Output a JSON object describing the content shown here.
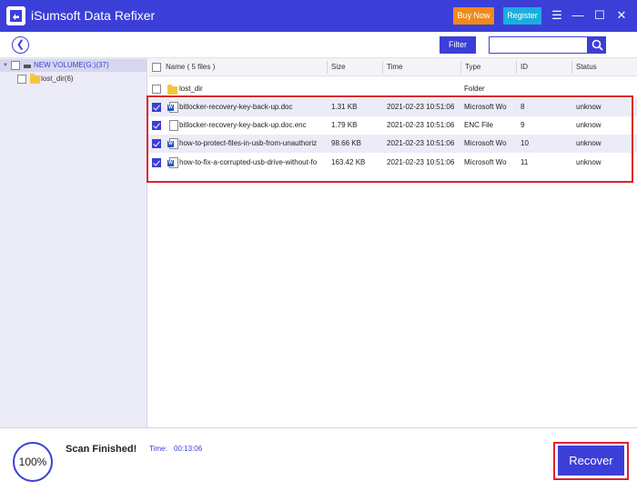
{
  "app": {
    "title": "iSumsoft Data Refixer",
    "buy_label": "Buy Now",
    "register_label": "Register",
    "menu_glyph": "☰",
    "minimize_glyph": "—",
    "maximize_glyph": "☐",
    "close_glyph": "✕"
  },
  "toolbar": {
    "back_glyph": "❮",
    "filter_label": "Filter",
    "search_value": "",
    "search_icon": "search-icon"
  },
  "tree": {
    "items": [
      {
        "label": "NEW VOLUME(G:)(37)",
        "icon": "drive-icon",
        "expanded": true,
        "checked": false
      },
      {
        "label": "lost_dir(6)",
        "icon": "folder-icon",
        "checked": false
      }
    ]
  },
  "list": {
    "columns": [
      "Name ( 5 files )",
      "Size",
      "Time",
      "Type",
      "ID",
      "Status"
    ],
    "rows": [
      {
        "name": "lost_dir",
        "size": "",
        "time": "",
        "type": "Folder",
        "id": "",
        "status": "",
        "icon": "folder-icon",
        "checked": false
      },
      {
        "name": "bitlocker-recovery-key-back-up.doc",
        "size": "1.31 KB",
        "time": "2021-02-23 10:51:06",
        "type": "Microsoft Wo",
        "id": "8",
        "status": "unknow",
        "icon": "word-doc-icon",
        "checked": true
      },
      {
        "name": "bitlocker-recovery-key-back-up.doc.enc",
        "size": "1.79 KB",
        "time": "2021-02-23 10:51:06",
        "type": "ENC File",
        "id": "9",
        "status": "unknow",
        "icon": "file-icon",
        "checked": true
      },
      {
        "name": "how-to-protect-files-in-usb-from-unauthoriz",
        "size": "98.66 KB",
        "time": "2021-02-23 10:51:06",
        "type": "Microsoft Wo",
        "id": "10",
        "status": "unknow",
        "icon": "word-doc-icon",
        "checked": true
      },
      {
        "name": "how-to-fix-a-corrupted-usb-drive-without-fo",
        "size": "163.42 KB",
        "time": "2021-02-23 10:51:06",
        "type": "Microsoft Wo",
        "id": "11",
        "status": "unknow",
        "icon": "word-doc-icon",
        "checked": true
      }
    ]
  },
  "bottom": {
    "progress": "100%",
    "scan_status": "Scan Finished!",
    "time_label": "Time:",
    "time_value": "00:13:06",
    "recover_label": "Recover"
  },
  "colors": {
    "accent": "#3b3fd8",
    "buy": "#f08a1c",
    "register": "#19aee0",
    "highlight": "#e0202c"
  }
}
